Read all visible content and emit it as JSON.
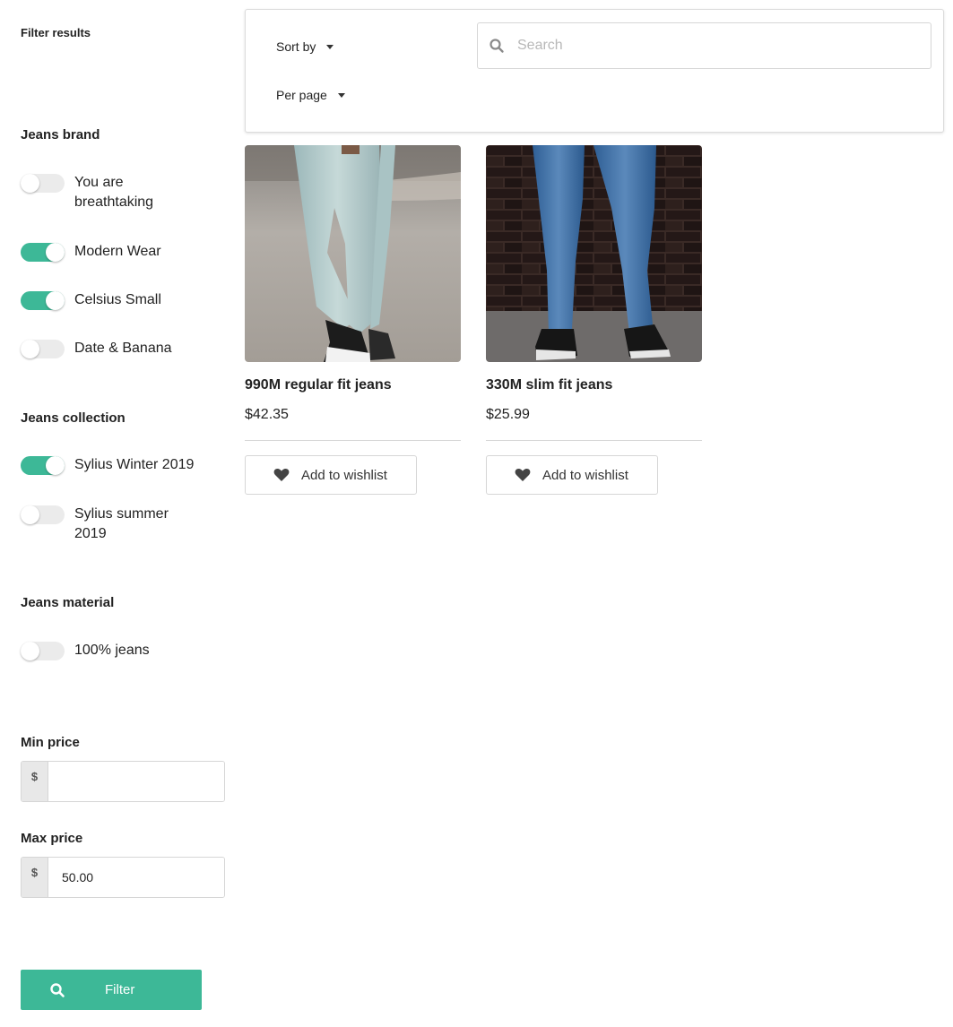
{
  "sidebar": {
    "title": "Filter results",
    "brand": {
      "title": "Jeans brand",
      "options": [
        {
          "label": "You are breathtaking",
          "checked": false
        },
        {
          "label": "Modern Wear",
          "checked": true
        },
        {
          "label": "Celsius Small",
          "checked": true
        },
        {
          "label": "Date & Banana",
          "checked": false
        }
      ]
    },
    "collection": {
      "title": "Jeans collection",
      "options": [
        {
          "label": "Sylius Winter 2019",
          "checked": true
        },
        {
          "label": "Sylius summer 2019",
          "checked": false
        }
      ]
    },
    "material": {
      "title": "Jeans material",
      "options": [
        {
          "label": "100% jeans",
          "checked": false
        }
      ]
    },
    "min_price": {
      "label": "Min price",
      "currency": "$",
      "value": ""
    },
    "max_price": {
      "label": "Max price",
      "currency": "$",
      "value": "50.00"
    },
    "filter_button": {
      "label": "Filter",
      "icon": "search-icon"
    }
  },
  "toolbar": {
    "sort_by": "Sort by",
    "per_page": "Per page",
    "search": {
      "placeholder": "Search",
      "value": ""
    }
  },
  "products": [
    {
      "name": "990M regular fit jeans",
      "price": "$42.35",
      "wishlist_label": "Add to wishlist"
    },
    {
      "name": "330M slim fit jeans",
      "price": "$25.99",
      "wishlist_label": "Add to wishlist"
    }
  ],
  "colors": {
    "accent": "#3db897",
    "toggle_off": "#ebebeb",
    "border": "#d6d6d6"
  }
}
